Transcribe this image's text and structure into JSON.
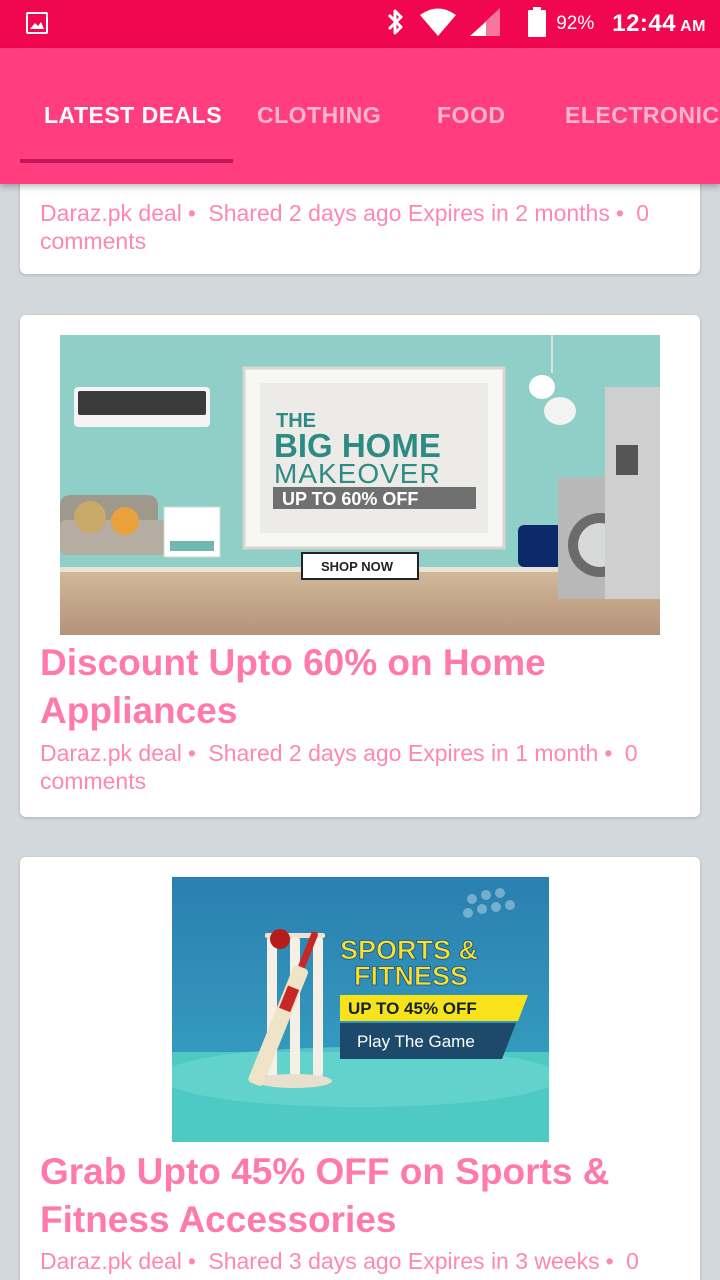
{
  "status_bar": {
    "battery_percent": "92%",
    "time": "12:44",
    "ampm": "AM",
    "icons": [
      "gallery-icon",
      "bluetooth-icon",
      "wifi-icon",
      "signal-icon",
      "battery-icon"
    ]
  },
  "tabs": [
    {
      "label": "LATEST DEALS",
      "active": true
    },
    {
      "label": "CLOTHING",
      "active": false
    },
    {
      "label": "FOOD",
      "active": false
    },
    {
      "label": "ELECTRONIC",
      "active": false
    }
  ],
  "colors": {
    "status_bar": "#f0074f",
    "tab_bar": "#ff3d7f",
    "indicator": "#c2185b",
    "accent_text": "#ff79ad",
    "background": "#d3d8dd"
  },
  "deals": [
    {
      "title": "",
      "source": "Daraz.pk deal",
      "shared": "Shared 2 days ago",
      "expires": "Expires in 2 months",
      "comments": "0 comments"
    },
    {
      "title": "Discount Upto 60% on Home Appliances",
      "source": "Daraz.pk deal",
      "shared": "Shared 2 days ago",
      "expires": "Expires in 1 month",
      "comments": "0 comments",
      "banner": {
        "line1": "THE",
        "line2": "BIG HOME",
        "line3": "MAKEOVER",
        "offer": "UP TO 60% OFF",
        "button": "SHOP NOW"
      }
    },
    {
      "title": "Grab Upto 45% OFF on Sports & Fitness Accessories",
      "source": "Daraz.pk deal",
      "shared": "Shared 3 days ago",
      "expires": "Expires in 3 weeks",
      "comments": "0",
      "banner": {
        "line1": "SPORTS  &",
        "line2": "FITNESS",
        "offer": "UP TO 45% OFF",
        "tagline": "Play The Game"
      }
    }
  ]
}
